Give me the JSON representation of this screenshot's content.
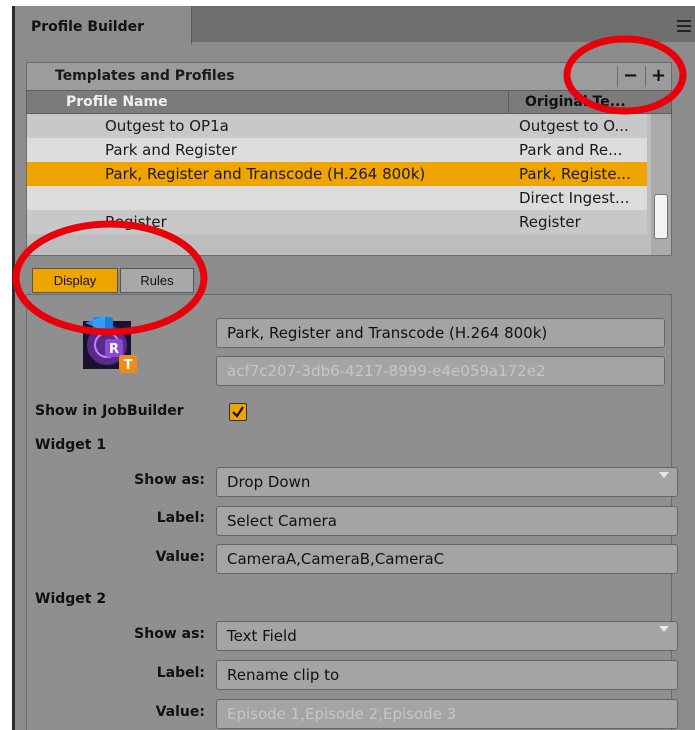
{
  "panel": {
    "tab_title": "Profile Builder",
    "menu_icon": "hamburger-menu-icon"
  },
  "templates": {
    "title": "Templates and Profiles",
    "minus_label": "−",
    "plus_label": "+",
    "columns": [
      "Profile Name",
      "Original Te..."
    ],
    "rows": [
      {
        "name": "Outgest to OP1a",
        "original": "Outgest to O..."
      },
      {
        "name": "Park and Register",
        "original": "Park and Re..."
      },
      {
        "name": "Park, Register and Transcode (H.264 800k)",
        "original": "Park, Registe...",
        "selected": true
      },
      {
        "name": "",
        "original": "Direct Ingest..."
      },
      {
        "name": "Register",
        "original": "Register"
      }
    ]
  },
  "subtabs": [
    "Display",
    "Rules"
  ],
  "detail": {
    "profile_name": "Park, Register and Transcode (H.264 800k)",
    "profile_id": "acf7c207-3db6-4217-8999-e4e059a172e2",
    "show_in_jobbuilder_label": "Show in JobBuilder",
    "show_in_jobbuilder_checked": true,
    "widget1": {
      "title": "Widget 1",
      "show_as_label": "Show as:",
      "show_as": "Drop Down",
      "label_label": "Label:",
      "label": "Select Camera",
      "value_label": "Value:",
      "value": "CameraA,CameraB,CameraC"
    },
    "widget2": {
      "title": "Widget 2",
      "show_as_label": "Show as:",
      "show_as": "Text Field",
      "label_label": "Label:",
      "label": "Rename clip to",
      "value_label": "Value:",
      "value_placeholder": "Episode 1,Episode 2,Episode 3"
    }
  },
  "colors": {
    "accent": "#f0a400",
    "annotation": "#e8000a",
    "panel_bg": "#8c8c8c"
  }
}
